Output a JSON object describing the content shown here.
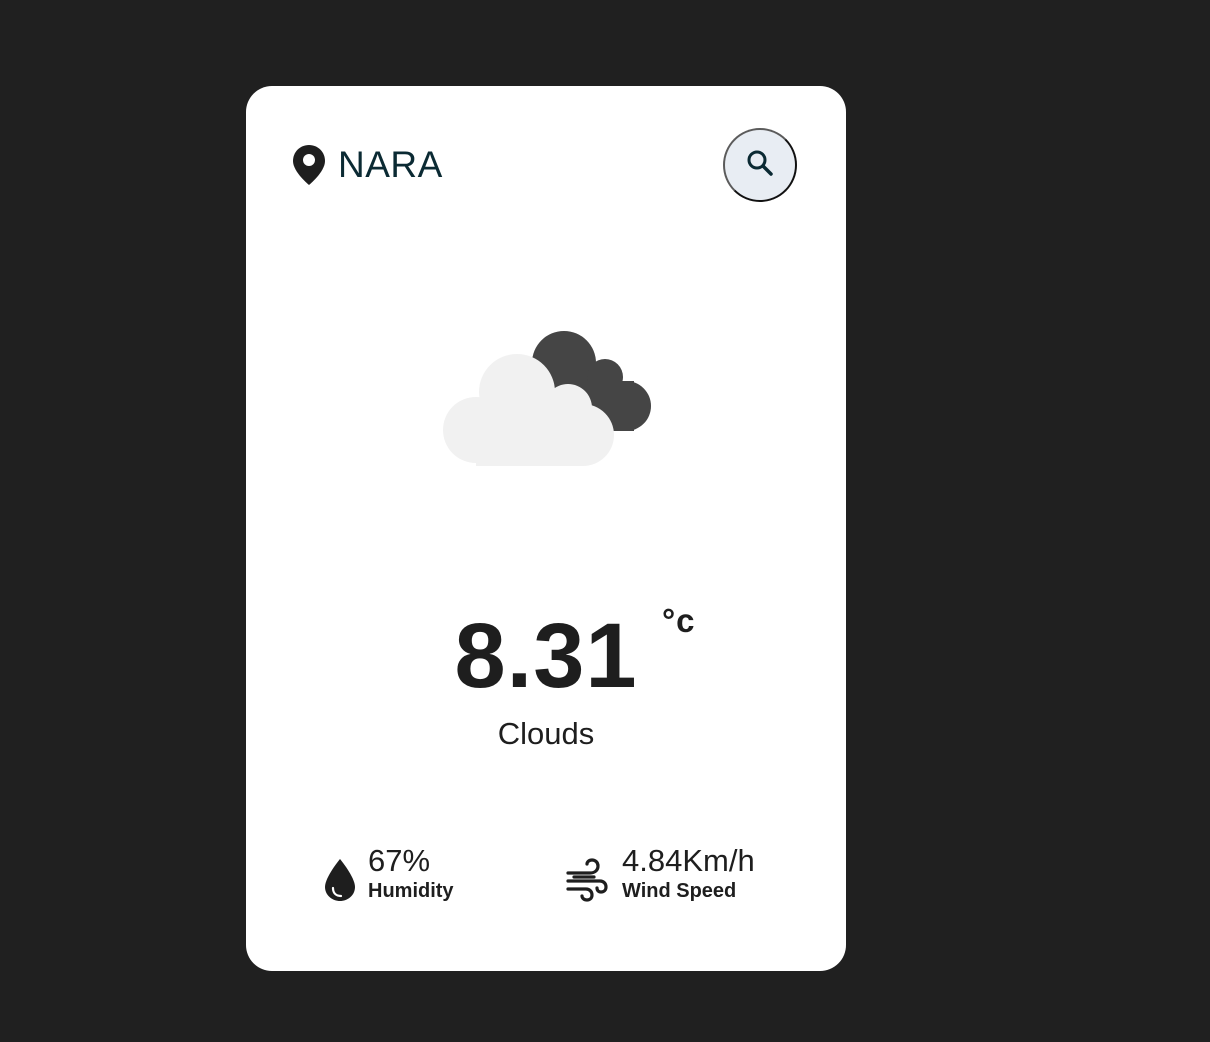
{
  "location": {
    "city": "NARA",
    "icon": "map-pin-icon"
  },
  "search": {
    "icon": "search-icon"
  },
  "weather": {
    "icon": "clouds-icon",
    "temperature": "8.31",
    "unit": "°c",
    "condition": "Clouds"
  },
  "stats": {
    "humidity": {
      "value": "67%",
      "label": "Humidity",
      "icon": "water-drop-icon"
    },
    "wind": {
      "value": "4.84Km/h",
      "label": "Wind Speed",
      "icon": "wind-icon"
    }
  },
  "colors": {
    "page_background": "#202020",
    "card_background": "#ffffff",
    "search_button_background": "#e8edf3",
    "text": "#1e1e1e",
    "city_text": "#0b2a33",
    "cloud_light": "#f1f1f1",
    "cloud_dark": "#454545"
  }
}
